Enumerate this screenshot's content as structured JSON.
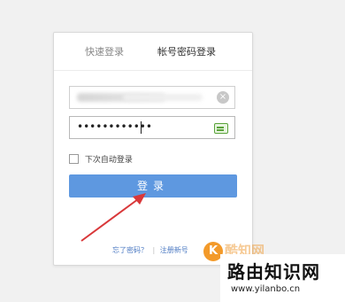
{
  "tabs": {
    "quick_login": "快速登录",
    "account_login": "帐号密码登录"
  },
  "password": {
    "masked": "••••••••••••"
  },
  "remember": {
    "label": "下次自动登录"
  },
  "login_button": {
    "label": "登录"
  },
  "links": {
    "forgot": "忘了密码？",
    "separator": "|",
    "register": "注册新号"
  },
  "watermark": {
    "logo_letter": "K",
    "brand": "酷知网",
    "title": "路由知识网",
    "url": "www.yilanbo.cn"
  },
  "colors": {
    "accent": "#5e98e0",
    "arrow": "#d9383a",
    "keyboard_icon": "#5aa33b"
  }
}
